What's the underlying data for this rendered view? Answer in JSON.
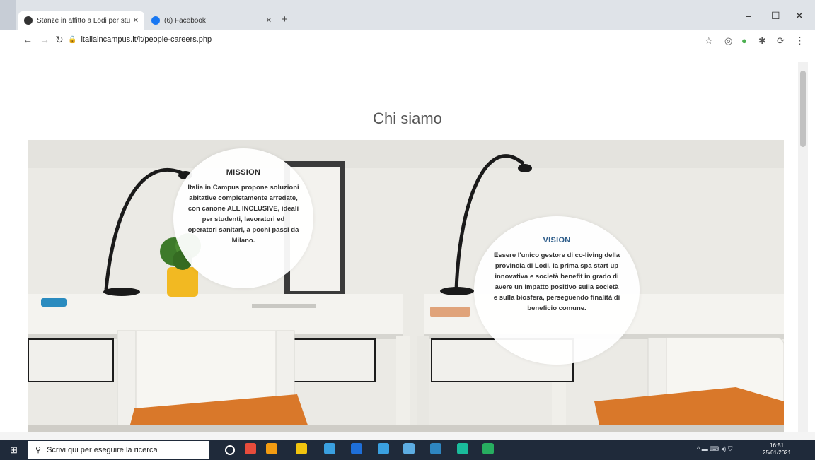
{
  "browser": {
    "tabs": [
      {
        "label": "Stanze in affitto a Lodi per stu",
        "favicon_color": "#333333"
      },
      {
        "label": "(6) Facebook",
        "favicon_color": "#1877f2"
      }
    ],
    "url": "italiaincampus.it/it/people-careers.php",
    "window_controls": {
      "minimize": "–",
      "maximize": "☐",
      "close": "✕"
    },
    "icons": [
      "back-icon",
      "forward-icon",
      "reload-icon",
      "lock-icon",
      "star-icon",
      "extensions-icon",
      "profile-icon",
      "menu-icon"
    ]
  },
  "page": {
    "title": "Chi siamo",
    "mission": {
      "heading": "MISSION",
      "text": "Italia in Campus propone soluzioni abitative completamente arredate, con canone ALL INCLUSIVE, ideali per studenti, lavoratori ed operatori sanitari, a pochi passi da Milano."
    },
    "vision": {
      "heading": "VISION",
      "text": "Essere l'unico gestore di co-living della provincia di Lodi, la prima spa start up innovativa e società benefit in grado di avere un impatto positivo sulla società e sulla biosfera, perseguendo finalità di beneficio comune."
    }
  },
  "taskbar": {
    "search_placeholder": "Scrivi qui per eseguire la ricerca",
    "time": "16:51",
    "date": "25/01/2021",
    "app_colors": [
      "#e74c3c",
      "#f39c12",
      "#f1c40f",
      "#3aa0e0",
      "#1e6fd9",
      "#3aa0e0",
      "#5dade2",
      "#2e86c1",
      "#1abc9c",
      "#27ae60"
    ]
  },
  "colors": {
    "accent_blue": "#2e5d8a",
    "chrome_bg": "#dfe3e8",
    "taskbar_bg": "#1f2a3a"
  }
}
